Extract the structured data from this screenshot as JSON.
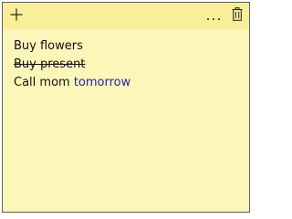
{
  "toolbar": {
    "add_icon": "plus-icon",
    "more_icon": "ellipsis-icon",
    "delete_icon": "trash-icon"
  },
  "note": {
    "background_color": "#fdf6b9",
    "titlebar_color": "#f9ef99",
    "lines": [
      {
        "text": "Buy flowers",
        "strikethrough": false
      },
      {
        "text": "Buy present",
        "strikethrough": true
      },
      {
        "text": "Call mom ",
        "link_text": "tomorrow",
        "strikethrough": false
      }
    ],
    "link_color": "#1a2a9c"
  }
}
